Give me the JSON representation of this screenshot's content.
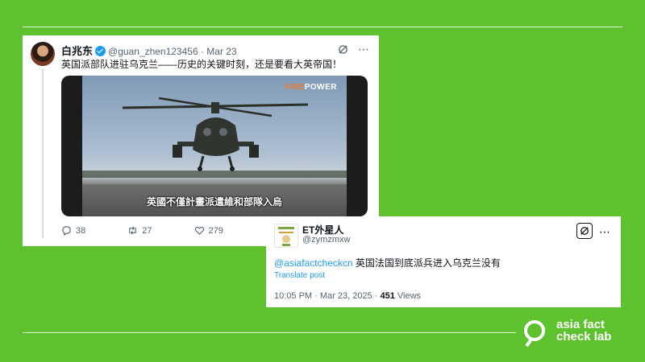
{
  "tweet1": {
    "author_name": "白兆东",
    "handle_date": "@guan_zhen123456 · Mar 23",
    "text": "英国派部队进驻乌克兰——历史的关键时刻，还是要看大英帝国！",
    "video": {
      "brand_part1": "FIRE",
      "brand_part2": "POWER",
      "subtitle": "英國不僅計畫派遣維和部隊入烏"
    },
    "stats": {
      "replies": "38",
      "reposts": "27",
      "likes": "279"
    }
  },
  "tweet2": {
    "author_name": "ET外星人",
    "handle": "@zymzmxw",
    "mention": "@asiafactcheckcn",
    "text": " 英国法国到底派兵进入乌克兰没有",
    "translate": "Translate post",
    "meta_time": "10:05 PM · Mar 23, 2025 · ",
    "views_count": "451",
    "views_label": " Views"
  },
  "logo": {
    "line1": "asia fact",
    "line2": "check lab"
  },
  "colors": {
    "background": "#5ec22e",
    "link": "#1d9bf0",
    "verified": "#1d9bf0"
  }
}
